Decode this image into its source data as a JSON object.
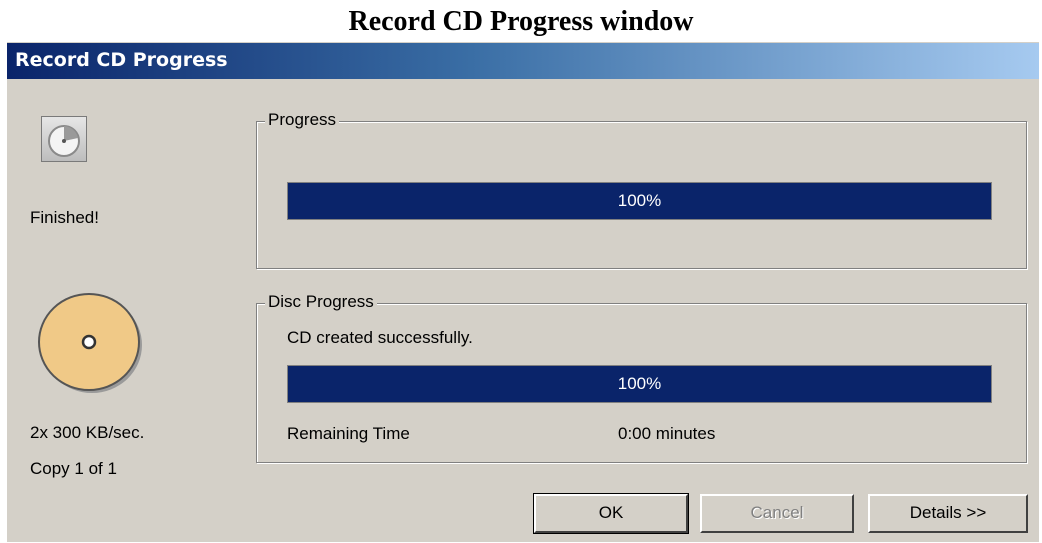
{
  "page_caption": "Record CD Progress window",
  "window": {
    "title": "Record CD Progress"
  },
  "left_panel": {
    "status": "Finished!",
    "speed": "2x 300 KB/sec.",
    "copy": "Copy 1 of 1",
    "status_icon": "progress-clock-icon",
    "disc_icon": "cd-disc-icon"
  },
  "progress_group": {
    "legend": "Progress",
    "bar_label": "100%",
    "value": 1.0
  },
  "disc_progress_group": {
    "legend": "Disc Progress",
    "message": "CD created successfully.",
    "bar_label": "100%",
    "value": 1.0,
    "remaining_label": "Remaining Time",
    "remaining_value": "0:00 minutes"
  },
  "buttons": {
    "ok": "OK",
    "cancel": "Cancel",
    "details": "Details >>"
  },
  "colors": {
    "progress_fill": "#0a246a",
    "disc": "#f0c987",
    "dialog_bg": "#d4d0c8"
  }
}
